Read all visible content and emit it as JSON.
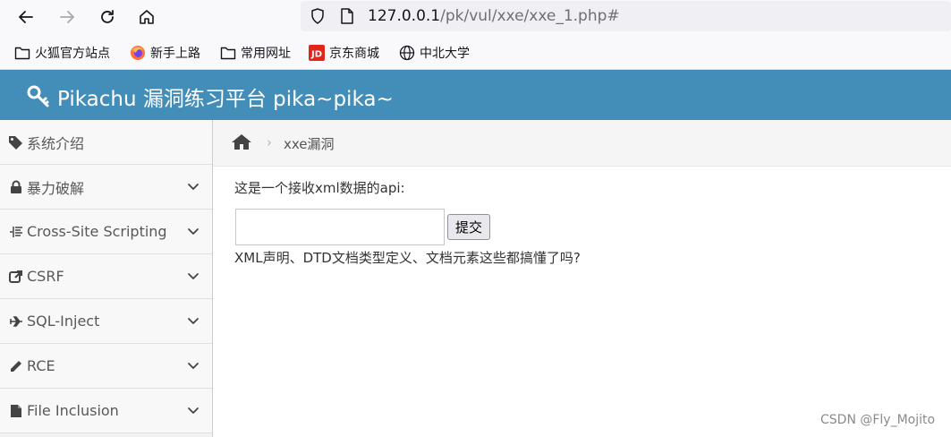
{
  "browser": {
    "url_host": "127.0.0.1",
    "url_path": "/pk/vul/xxe/xxe_1.php#"
  },
  "bookmarks": [
    {
      "label": "火狐官方站点",
      "icon": "folder-icon"
    },
    {
      "label": "新手上路",
      "icon": "firefox-icon"
    },
    {
      "label": "常用网址",
      "icon": "folder-icon"
    },
    {
      "label": "京东商城",
      "icon": "jd-icon"
    },
    {
      "label": "中北大学",
      "icon": "globe-icon"
    }
  ],
  "header": {
    "title": "Pikachu 漏洞练习平台 pika~pika~",
    "icon": "key-icon"
  },
  "sidebar": {
    "items": [
      {
        "label": "系统介绍",
        "icon": "tags-icon",
        "has_chevron": false
      },
      {
        "label": "暴力破解",
        "icon": "lock-icon",
        "has_chevron": true
      },
      {
        "label": "Cross-Site Scripting",
        "icon": "list-icon",
        "has_chevron": true
      },
      {
        "label": "CSRF",
        "icon": "share-icon",
        "has_chevron": true
      },
      {
        "label": "SQL-Inject",
        "icon": "plane-icon",
        "has_chevron": true
      },
      {
        "label": "RCE",
        "icon": "pencil-icon",
        "has_chevron": true
      },
      {
        "label": "File Inclusion",
        "icon": "file-icon",
        "has_chevron": true
      }
    ]
  },
  "breadcrumb": {
    "separator": "›",
    "current": "xxe漏洞"
  },
  "main": {
    "prompt": "这是一个接收xml数据的api:",
    "input_value": "",
    "submit_label": "提交",
    "hint": "XML声明、DTD文档类型定义、文档元素这些都搞懂了吗?"
  },
  "watermark": "CSDN @Fly_Mojito",
  "colors": {
    "header_bg": "#438eb9",
    "sidebar_bg": "#f8f8f8",
    "breadcrumb_bg": "#f5f5f5"
  }
}
